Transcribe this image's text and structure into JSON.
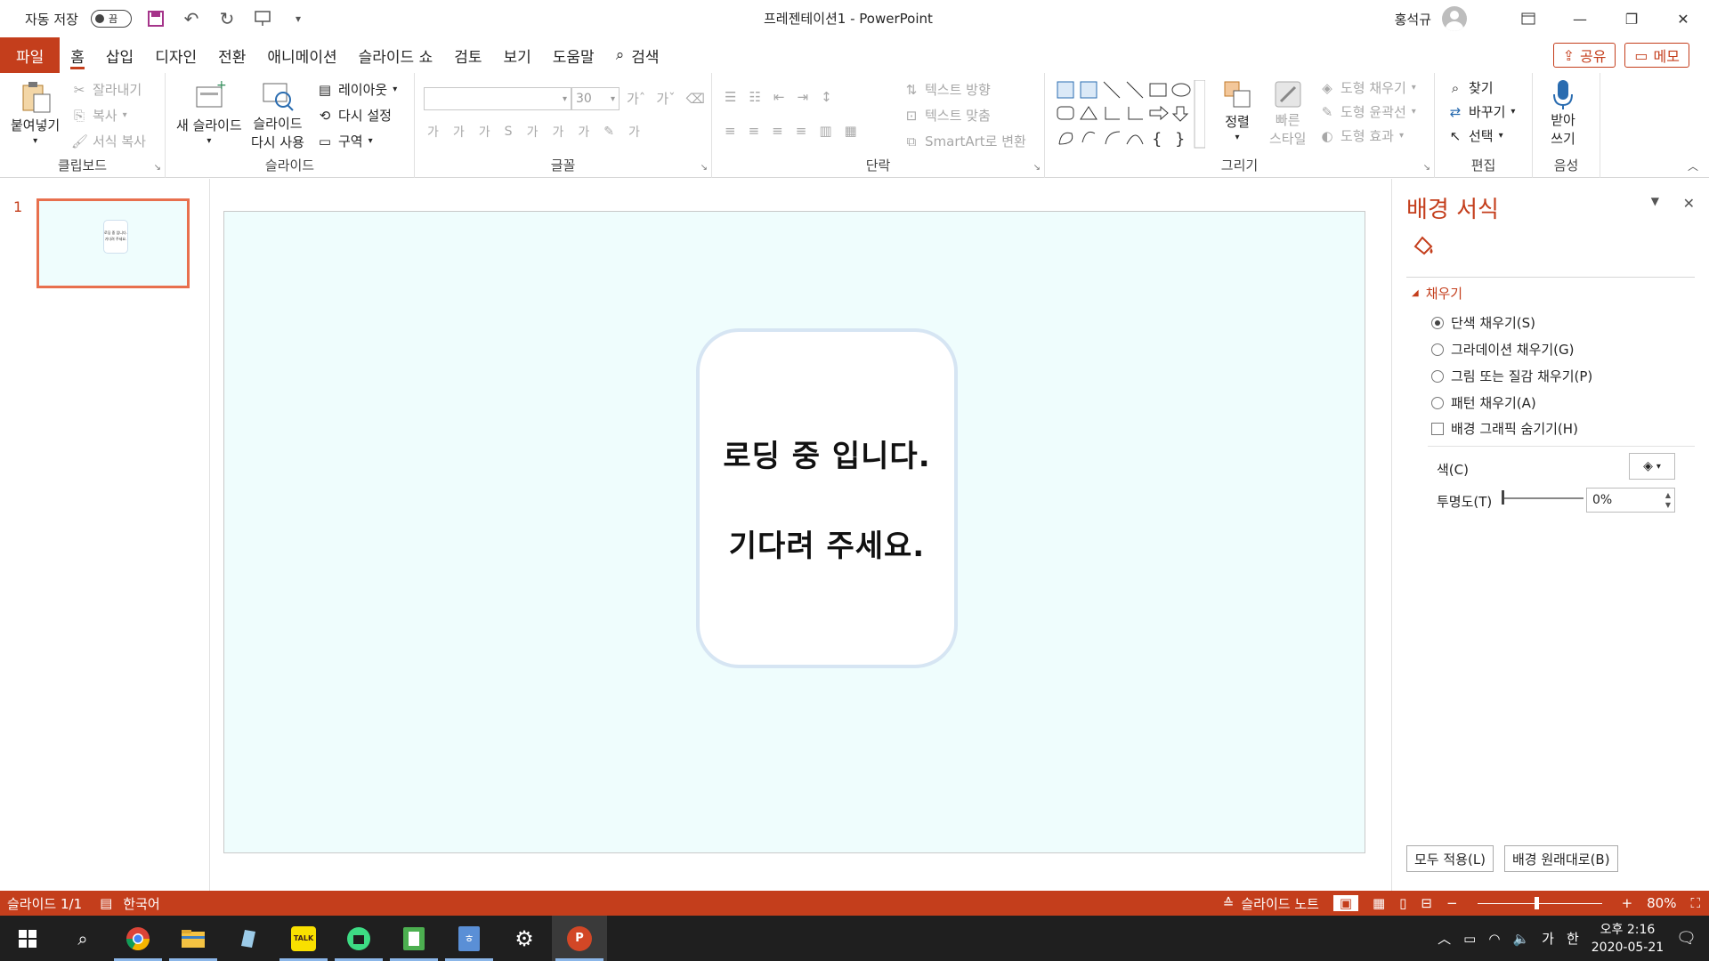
{
  "titlebar": {
    "autosave_label": "자동 저장",
    "autosave_state": "끔",
    "title": "프레젠테이션1  -  PowerPoint",
    "user": "홍석규"
  },
  "tabs": {
    "items": [
      "파일",
      "홈",
      "삽입",
      "디자인",
      "전환",
      "애니메이션",
      "슬라이드 쇼",
      "검토",
      "보기",
      "도움말"
    ],
    "search": "검색",
    "share": "공유",
    "memo": "메모"
  },
  "ribbon": {
    "clipboard": {
      "label": "클립보드",
      "paste": "붙여넣기",
      "cut": "잘라내기",
      "copy": "복사",
      "format_copy": "서식 복사"
    },
    "slides": {
      "label": "슬라이드",
      "new_slide": "새 슬라이드",
      "reuse1": "슬라이드",
      "reuse2": "다시 사용",
      "layout": "레이아웃",
      "reset": "다시 설정",
      "section": "구역"
    },
    "font": {
      "label": "글꼴",
      "size": "30"
    },
    "paragraph": {
      "label": "단락",
      "text_direction": "텍스트 방향",
      "align_text": "텍스트 맞춤",
      "smartart": "SmartArt로 변환"
    },
    "drawing": {
      "label": "그리기",
      "arrange": "정렬",
      "quick1": "빠른",
      "quick2": "스타일",
      "fill": "도형 채우기",
      "outline": "도형 윤곽선",
      "effect": "도형 효과"
    },
    "editing": {
      "label": "편집",
      "find": "찾기",
      "replace": "바꾸기",
      "select": "선택"
    },
    "voice": {
      "label": "음성",
      "dictate1": "받아",
      "dictate2": "쓰기"
    }
  },
  "thumbnails": {
    "number": "1",
    "line1": "로딩 중 입니다.",
    "line2": "기다려 주세요."
  },
  "slide": {
    "line1": "로딩 중 입니다.",
    "line2": "기다려 주세요.",
    "background_color": "#effdfd"
  },
  "format_pane": {
    "title": "배경 서식",
    "section": "채우기",
    "options": [
      "단색 채우기(S)",
      "그라데이션 채우기(G)",
      "그림 또는 질감 채우기(P)",
      "패턴 채우기(A)"
    ],
    "hide_graphics": "배경 그래픽 숨기기(H)",
    "color_label": "색(C)",
    "transparency_label": "투명도(T)",
    "transparency_value": "0%",
    "apply_all": "모두 적용(L)",
    "reset_bg": "배경 원래대로(B)"
  },
  "statusbar": {
    "slide_count": "슬라이드 1/1",
    "language": "한국어",
    "notes": "슬라이드 노트",
    "zoom": "80%"
  },
  "taskbar": {
    "time": "오후 2:16",
    "date": "2020-05-21",
    "ime1": "가",
    "ime2": "한"
  },
  "colors": {
    "accent": "#c43e1c",
    "slide_bg": "#effdfd"
  }
}
